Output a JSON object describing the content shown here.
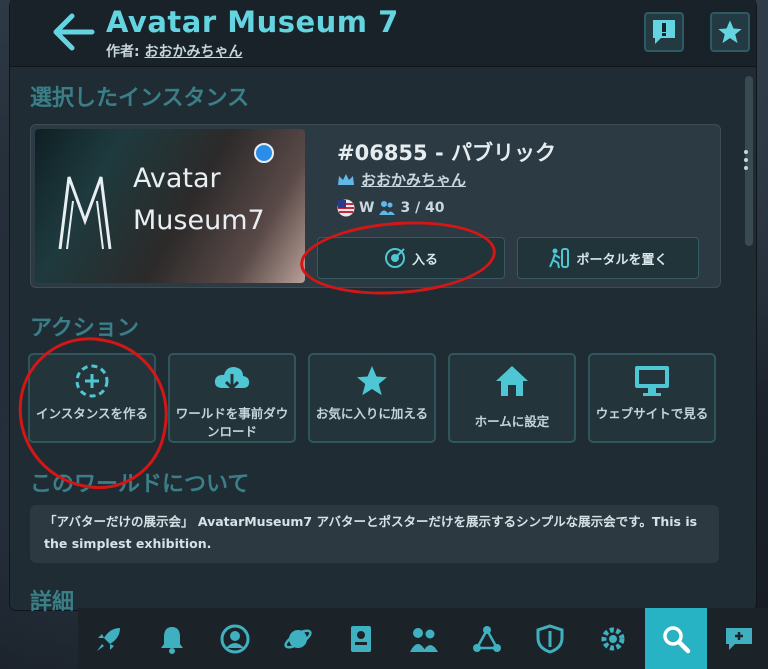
{
  "header": {
    "title": "Avatar Museum 7",
    "author_label": "作者:",
    "author_name": "おおかみちゃん"
  },
  "selected_instance": {
    "heading": "選択したインスタンス",
    "thumbnail_text_line1": "Avatar",
    "thumbnail_text_line2": "Museum7",
    "id_title": "#06855 - パブリック",
    "owner": "おおかみちゃん",
    "region": "W",
    "players": "3 / 40",
    "join_label": "入る",
    "portal_label": "ポータルを置く"
  },
  "actions": {
    "heading": "アクション",
    "items": [
      {
        "label": "インスタンスを作る",
        "icon": "create-instance-icon"
      },
      {
        "label": "ワールドを事前ダウンロード",
        "icon": "download-icon"
      },
      {
        "label": "お気に入りに加える",
        "icon": "star-icon"
      },
      {
        "label": "ホームに設定",
        "icon": "home-icon"
      },
      {
        "label": "ウェブサイトで見る",
        "icon": "monitor-icon"
      }
    ]
  },
  "about": {
    "heading": "このワールドについて",
    "description": "「アバターだけの展示会」 AvatarMuseum7 アバターとポスターだけを展示するシンプルな展示会です。This is the simplest exhibition."
  },
  "details": {
    "heading": "詳細"
  },
  "bottom_nav": [
    "rocket-icon",
    "bell-icon",
    "person-icon",
    "planet-icon",
    "id-card-icon",
    "people-icon",
    "network-icon",
    "shield-icon",
    "gear-icon",
    "search-icon",
    "chat-add-icon"
  ],
  "colors": {
    "accent": "#63d4e0",
    "active_tab": "#27b3c4",
    "annotation": "#d51616"
  }
}
